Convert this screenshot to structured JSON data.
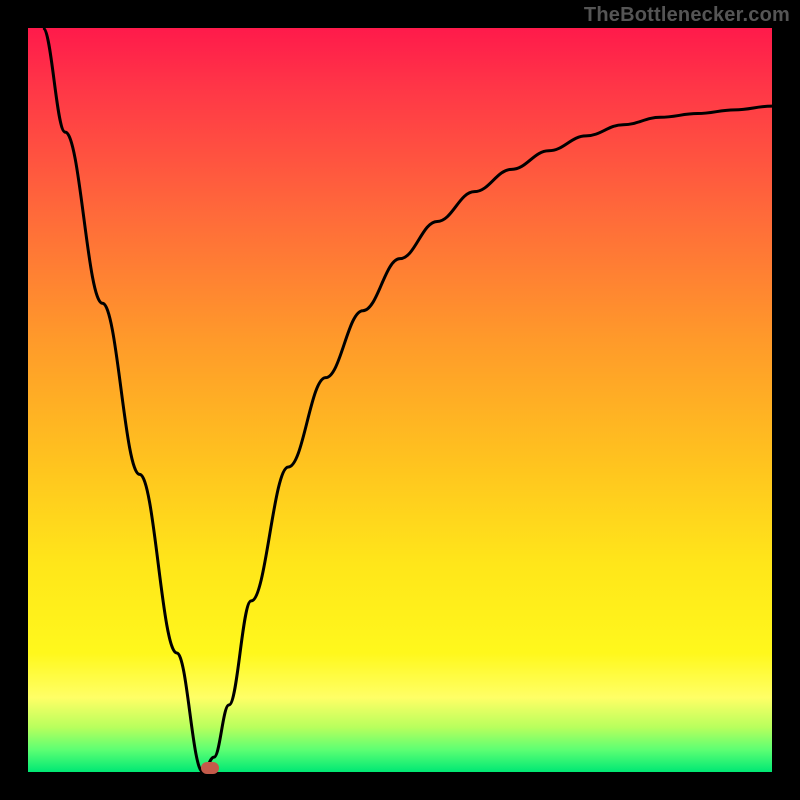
{
  "attribution": "TheBottlenecker.com",
  "colors": {
    "frame": "#000000",
    "curve": "#000000",
    "marker": "#c45a4a",
    "attribution": "#555555"
  },
  "chart_data": {
    "type": "line",
    "title": "",
    "xlabel": "",
    "ylabel": "",
    "xlim": [
      0,
      1
    ],
    "ylim": [
      0,
      1
    ],
    "series": [
      {
        "name": "curve",
        "x": [
          0.02,
          0.05,
          0.1,
          0.15,
          0.2,
          0.235,
          0.25,
          0.27,
          0.3,
          0.35,
          0.4,
          0.45,
          0.5,
          0.55,
          0.6,
          0.65,
          0.7,
          0.75,
          0.8,
          0.85,
          0.9,
          0.95,
          1.0
        ],
        "y": [
          1.0,
          0.86,
          0.63,
          0.4,
          0.16,
          0.0,
          0.02,
          0.09,
          0.23,
          0.41,
          0.53,
          0.62,
          0.69,
          0.74,
          0.78,
          0.81,
          0.835,
          0.855,
          0.87,
          0.88,
          0.885,
          0.89,
          0.895
        ]
      }
    ],
    "marker": {
      "x": 0.245,
      "y": 0.005
    }
  }
}
